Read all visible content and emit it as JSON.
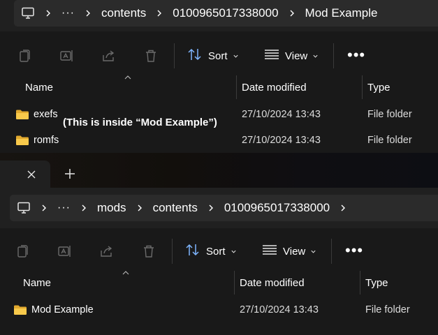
{
  "window1": {
    "breadcrumb": [
      "contents",
      "0100965017338000",
      "Mod Example"
    ],
    "toolbar": {
      "sort_label": "Sort",
      "view_label": "View",
      "more_label": "•••"
    },
    "columns": {
      "name": "Name",
      "date": "Date modified",
      "type": "Type"
    },
    "rows": [
      {
        "name": "exefs",
        "date": "27/10/2024 13:43",
        "type": "File folder"
      },
      {
        "name": "romfs",
        "date": "27/10/2024 13:43",
        "type": "File folder"
      }
    ],
    "caption": "(This is inside “Mod Example”)"
  },
  "window2": {
    "tab_close": "✕",
    "tab_new": "+",
    "breadcrumb": [
      "mods",
      "contents",
      "0100965017338000"
    ],
    "toolbar": {
      "sort_label": "Sort",
      "view_label": "View",
      "more_label": "•••"
    },
    "columns": {
      "name": "Name",
      "date": "Date modified",
      "type": "Type"
    },
    "rows": [
      {
        "name": "Mod Example",
        "date": "27/10/2024 13:43",
        "type": "File folder"
      }
    ]
  },
  "breadcrumb_overflow": "···",
  "colors": {
    "folder": "#f8c94b",
    "folder_dark": "#e0a82e",
    "background": "#191919",
    "addressbar": "#2b2b2b"
  },
  "icons": [
    "computer-icon",
    "copy-icon",
    "rename-icon",
    "share-icon",
    "delete-icon",
    "sort-icon",
    "view-icon",
    "folder-icon"
  ]
}
